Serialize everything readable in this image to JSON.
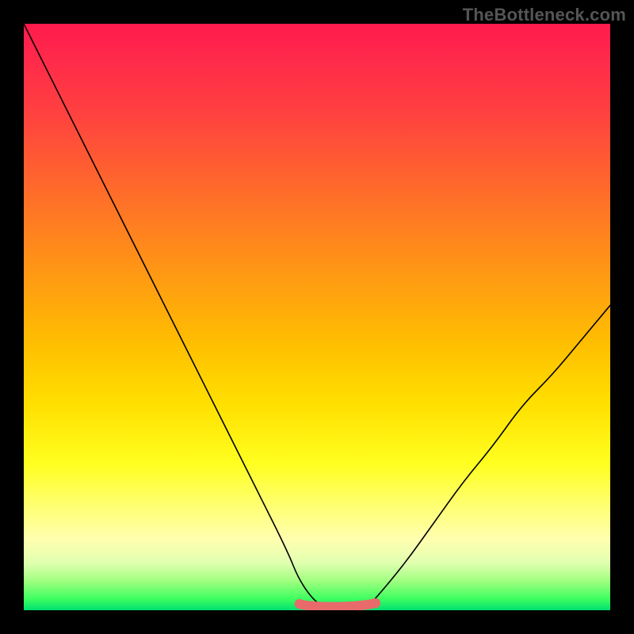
{
  "watermark": "TheBottleneck.com",
  "chart_data": {
    "type": "line",
    "title": "",
    "xlabel": "",
    "ylabel": "",
    "x": [
      0,
      5,
      10,
      15,
      20,
      25,
      30,
      35,
      40,
      45,
      47,
      50,
      53,
      55,
      58,
      60,
      65,
      70,
      75,
      80,
      85,
      90,
      95,
      100
    ],
    "values": [
      100,
      90,
      80,
      70,
      60,
      50,
      40,
      30,
      20,
      10,
      5,
      1,
      0,
      0,
      0,
      2,
      8,
      15,
      22,
      28,
      35,
      40,
      46,
      52
    ],
    "ylim": [
      0,
      100
    ],
    "xlim": [
      0,
      100
    ],
    "optimal_range": {
      "x_start": 47,
      "x_end": 60,
      "value": 0
    },
    "gradient_stops": [
      {
        "pos": 0.0,
        "color": "#ff1a4d"
      },
      {
        "pos": 0.15,
        "color": "#ff4040"
      },
      {
        "pos": 0.35,
        "color": "#ff8020"
      },
      {
        "pos": 0.55,
        "color": "#ffc000"
      },
      {
        "pos": 0.75,
        "color": "#ffff20"
      },
      {
        "pos": 0.9,
        "color": "#e0ffb0"
      },
      {
        "pos": 1.0,
        "color": "#00e070"
      }
    ]
  }
}
